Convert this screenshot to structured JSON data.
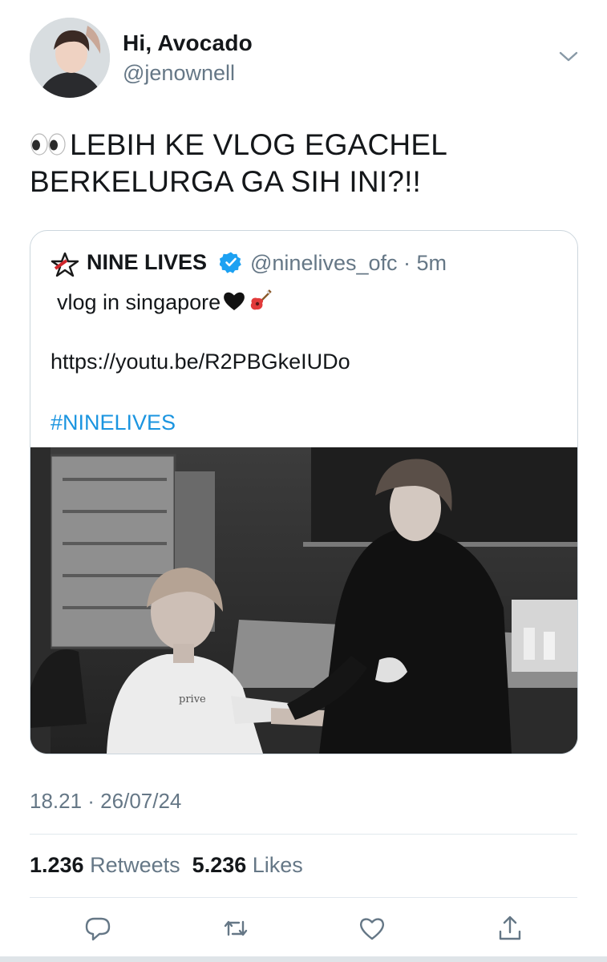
{
  "author": {
    "display_name": "Hi, Avocado",
    "handle": "@jenownell"
  },
  "tweet": {
    "emoji": "👀",
    "text_line1": "LEBIH KE VLOG EGACHEL",
    "text_line2": "BERKELURGA GA SIH INI?!!"
  },
  "quoted": {
    "name": "NINE LIVES",
    "handle_time": "@ninelives_ofc · 5m",
    "line1": "vlog in singapore",
    "emojis": [
      "black-heart",
      "guitar"
    ],
    "link": "https://youtu.be/R2PBGkeIUDo",
    "hashtag": "#NINELIVES",
    "shirt_text": "prive"
  },
  "timestamp": "18.21 · 26/07/24",
  "stats": {
    "retweets_count": "1.236",
    "retweets_label": "Retweets",
    "likes_count": "5.236",
    "likes_label": "Likes"
  },
  "colors": {
    "link_blue": "#1b95e0",
    "muted": "#657786",
    "verified": "#1da1f2"
  },
  "icons": [
    "chevron-down-icon",
    "verified-icon",
    "reply-icon",
    "retweet-icon",
    "like-icon",
    "share-icon"
  ]
}
